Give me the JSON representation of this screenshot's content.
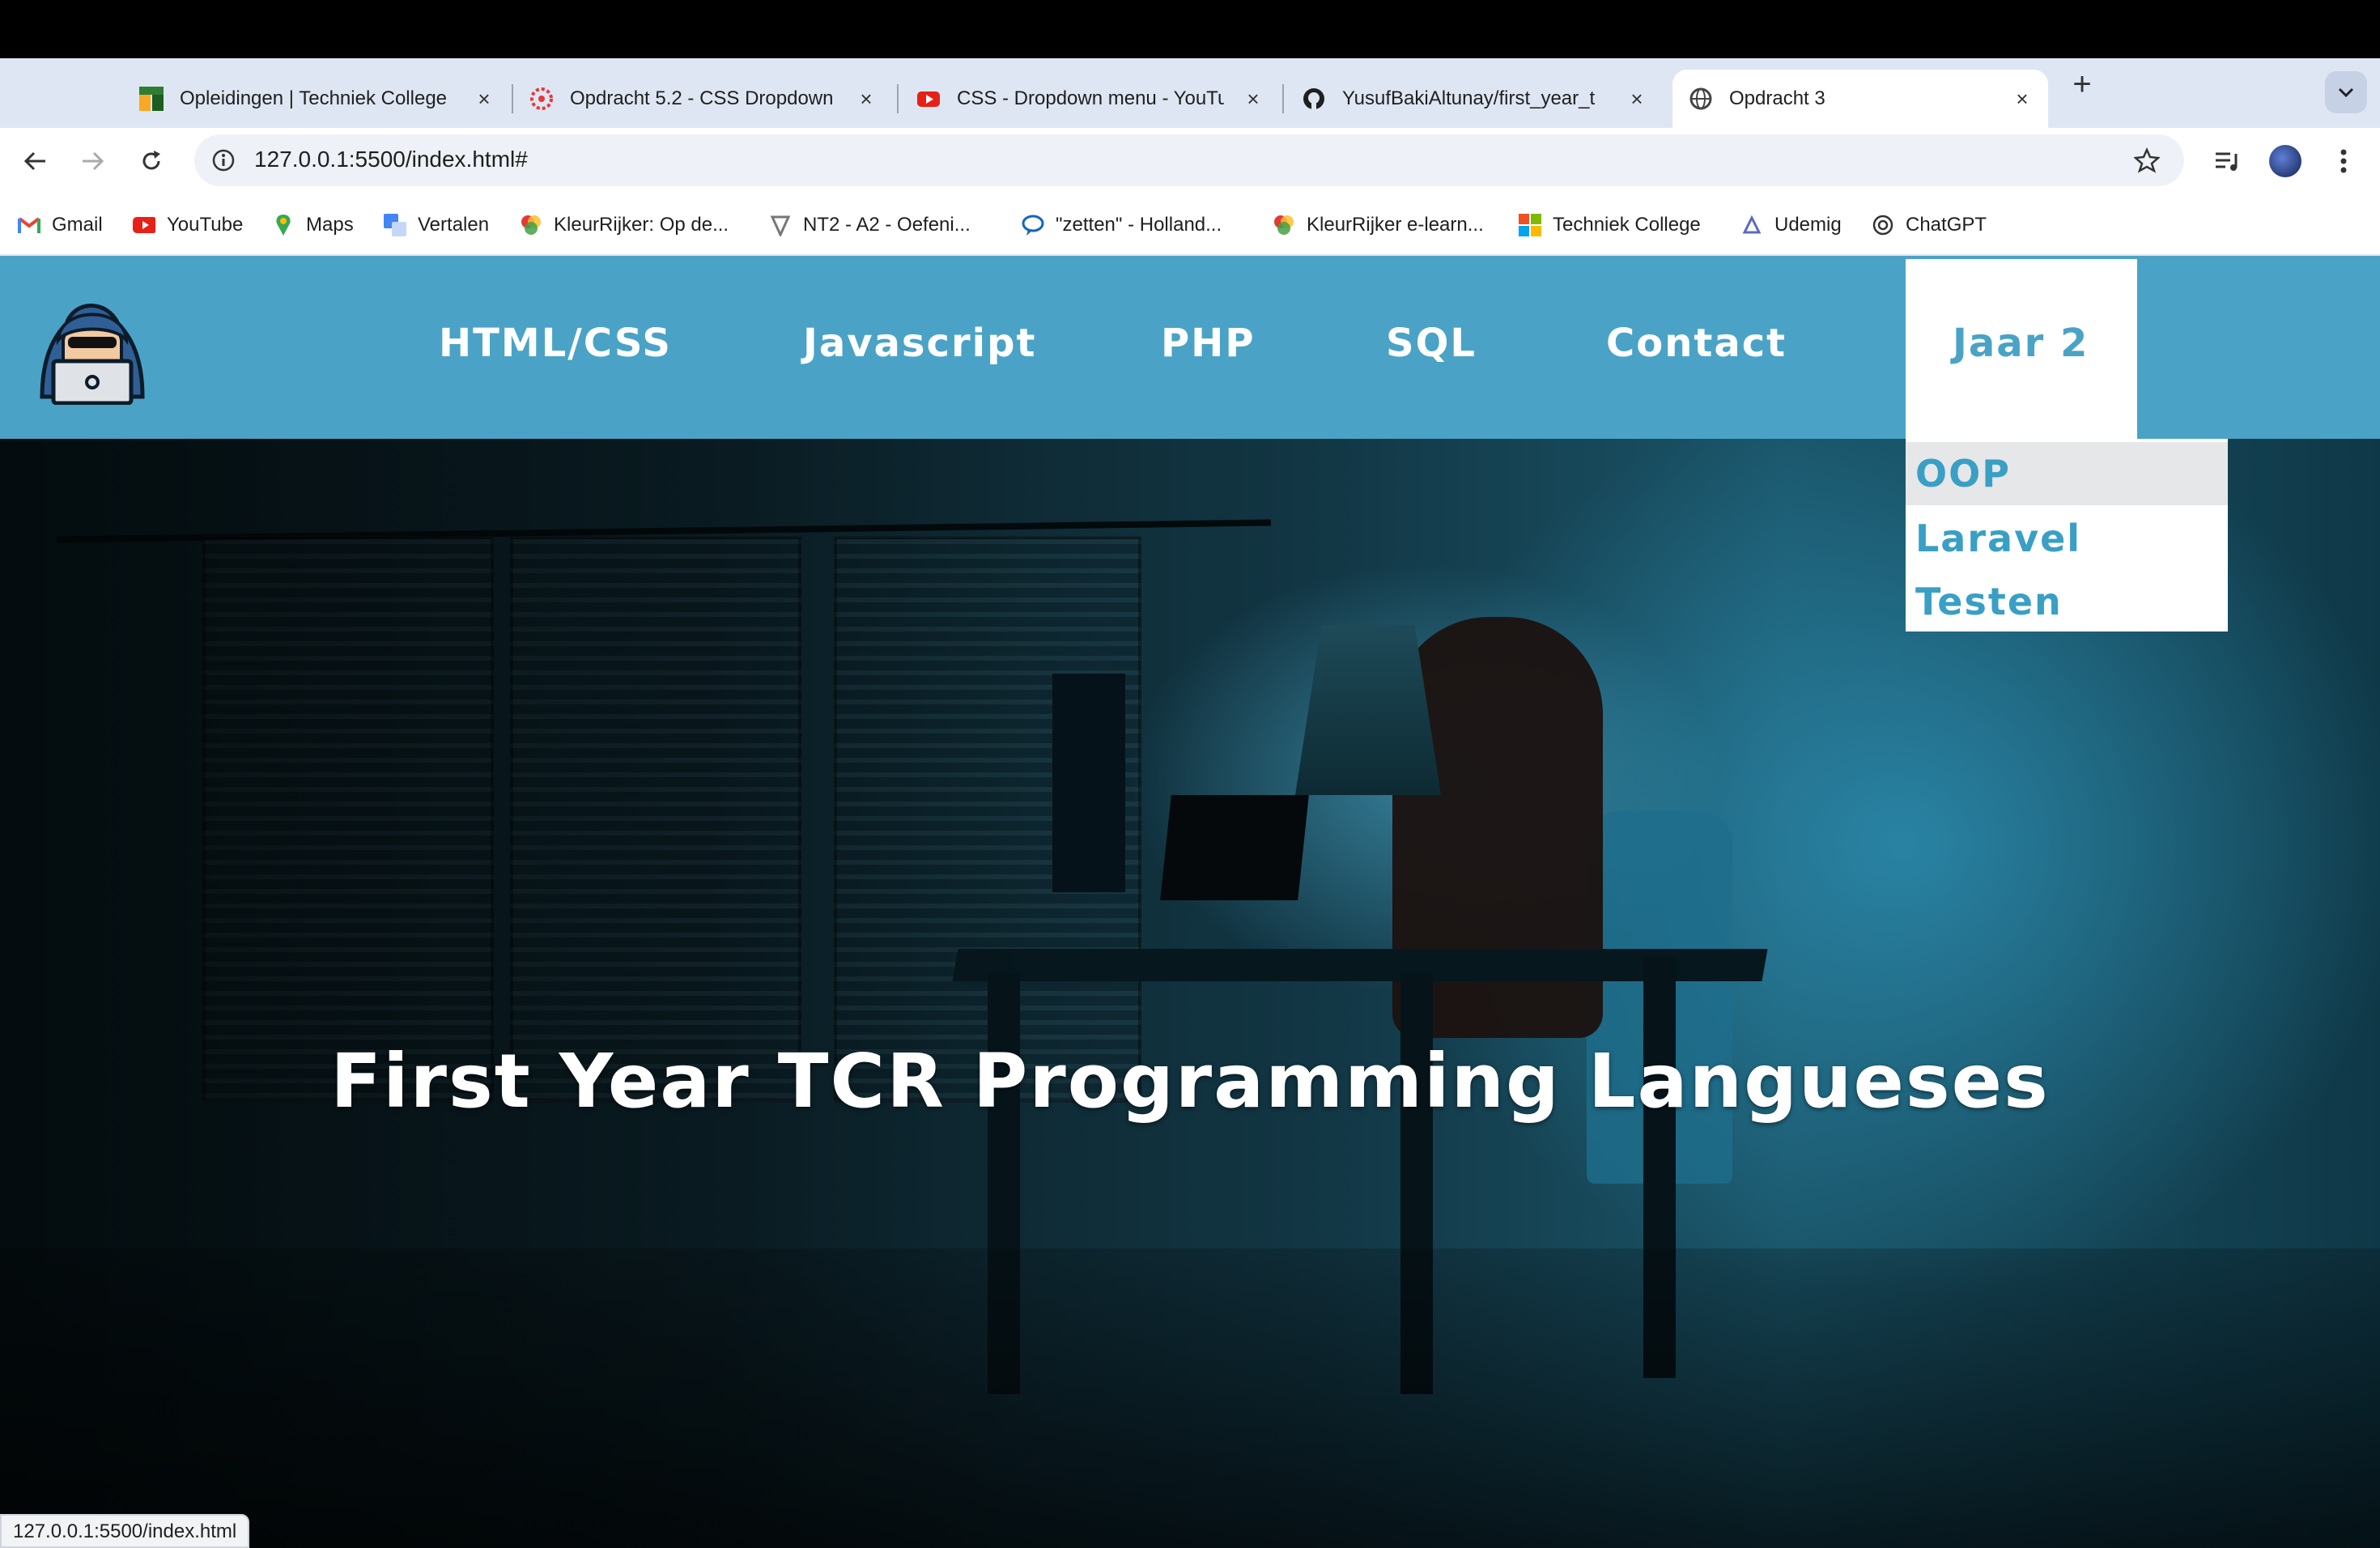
{
  "browser": {
    "tabs": [
      {
        "title": "Opleidingen | Techniek College",
        "icon": "techniek-college-favicon"
      },
      {
        "title": "Opdracht 5.2 - CSS Dropdown",
        "icon": "opdracht-favicon"
      },
      {
        "title": "CSS - Dropdown menu - YouTube",
        "icon": "youtube-favicon"
      },
      {
        "title": "YusufBakiAltunay/first_year_t",
        "icon": "github-favicon"
      },
      {
        "title": "Opdracht 3",
        "icon": "globe-favicon",
        "active": true
      }
    ],
    "url": "127.0.0.1:5500/index.html#",
    "bookmarks": [
      {
        "label": "Gmail",
        "icon": "gmail-icon"
      },
      {
        "label": "YouTube",
        "icon": "youtube-icon"
      },
      {
        "label": "Maps",
        "icon": "maps-icon"
      },
      {
        "label": "Vertalen",
        "icon": "translate-icon"
      },
      {
        "label": "KleurRijker: Op de...",
        "icon": "kleurrijker-icon"
      },
      {
        "label": "NT2 - A2 - Oefeni...",
        "icon": "nt2-icon"
      },
      {
        "label": "\"zetten\" - Holland...",
        "icon": "chat-bubble-icon"
      },
      {
        "label": "KleurRijker e-learn...",
        "icon": "kleurrijker-icon"
      },
      {
        "label": "Techniek College",
        "icon": "microsoft-icon"
      },
      {
        "label": "Udemig",
        "icon": "udemig-icon"
      },
      {
        "label": "ChatGPT",
        "icon": "chatgpt-icon"
      }
    ],
    "status_url": "127.0.0.1:5500/index.html"
  },
  "site": {
    "nav": [
      "HTML/CSS",
      "Javascript",
      "PHP",
      "SQL",
      "Contact"
    ],
    "active_nav": "Jaar 2",
    "dropdown": [
      "OOP",
      "Laravel",
      "Testen"
    ],
    "hero_title": "First Year TCR Programming Langueses",
    "colors": {
      "navbar": "#4aa3c6",
      "dropdown_text": "#3a9fc4",
      "hover_bg": "#e6e7e8"
    }
  }
}
